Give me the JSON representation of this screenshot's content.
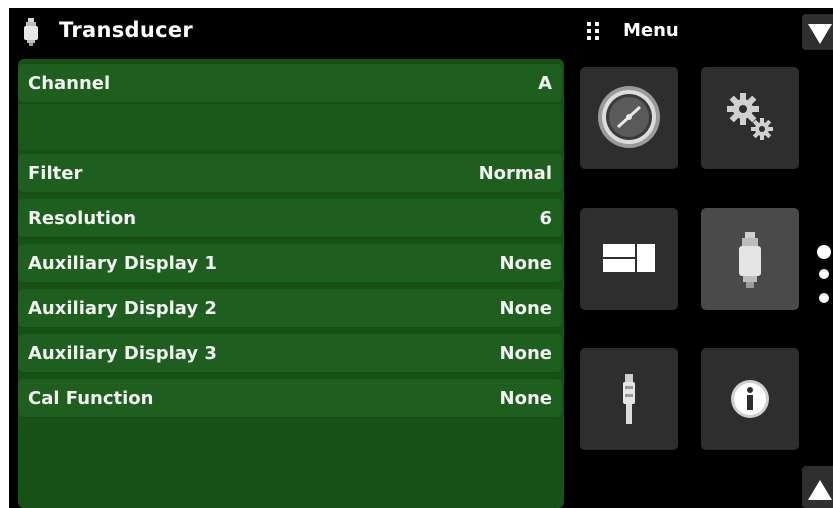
{
  "header": {
    "title": "Transducer",
    "menu_label": "Menu"
  },
  "settings": {
    "rows": [
      {
        "label": "Channel",
        "value": "A"
      },
      {
        "label": "Filter",
        "value": "Normal"
      },
      {
        "label": "Resolution",
        "value": "6"
      },
      {
        "label": "Auxiliary Display 1",
        "value": "None"
      },
      {
        "label": "Auxiliary Display 2",
        "value": "None"
      },
      {
        "label": "Auxiliary Display 3",
        "value": "None"
      },
      {
        "label": "Cal Function",
        "value": "None"
      }
    ]
  },
  "menu": {
    "tiles": [
      {
        "icon": "gauge-icon"
      },
      {
        "icon": "gears-icon"
      },
      {
        "icon": "split-display-icon"
      },
      {
        "icon": "transducer-icon",
        "active": true
      },
      {
        "icon": "cable-connector-icon"
      },
      {
        "icon": "info-icon"
      }
    ],
    "page_indicator": {
      "pages": 3,
      "current": 1
    }
  },
  "colors": {
    "background": "#000000",
    "panel": "#165216",
    "row": "#1e5e1e",
    "tile": "#2e2e2e",
    "tile_active": "#4a4a4a",
    "text": "#f2f2f2"
  }
}
